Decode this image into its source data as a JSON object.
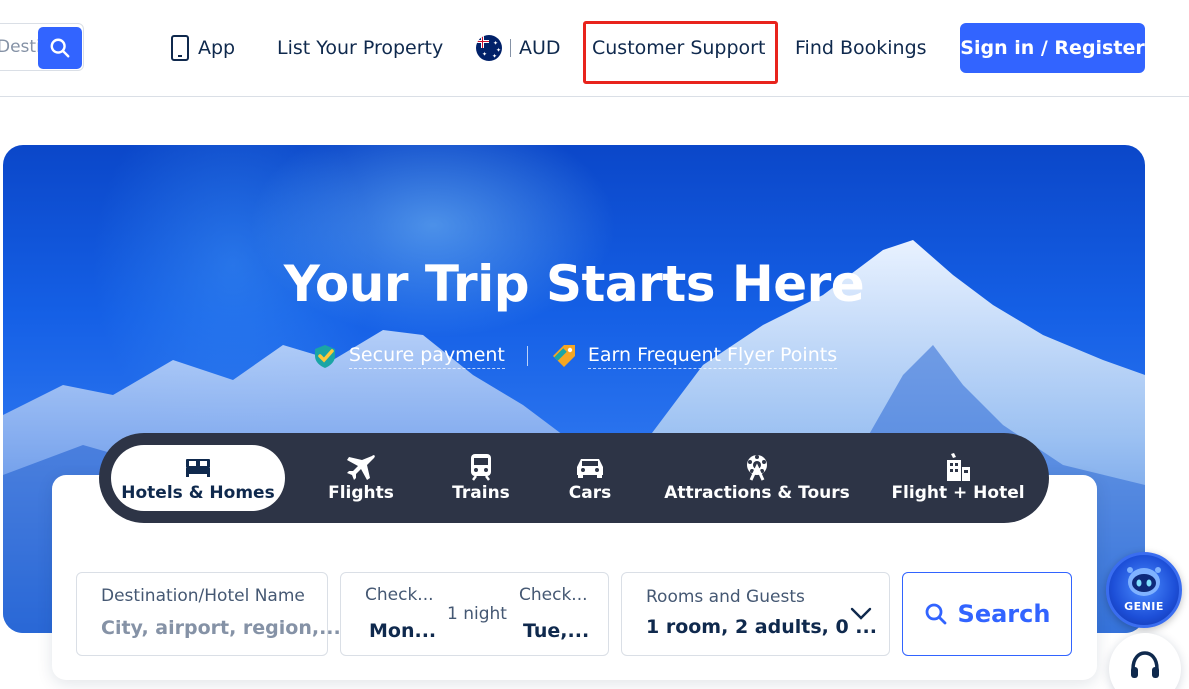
{
  "header": {
    "search_placeholder": "Desti...",
    "search_icon": "search-icon",
    "nav": {
      "app_label": "App",
      "list_property_label": "List Your Property",
      "currency_label": "AUD",
      "customer_support_label": "Customer Support",
      "find_bookings_label": "Find Bookings",
      "signin_label": "Sign in / Register"
    },
    "accent_color": "#3264ff",
    "highlight_color": "#e8231c"
  },
  "hero": {
    "title": "Your Trip Starts Here",
    "badges": [
      "Secure payment",
      "Earn Frequent Flyer Points"
    ]
  },
  "tabs": [
    {
      "label": "Hotels & Homes",
      "icon": "bed-icon",
      "active": true
    },
    {
      "label": "Flights",
      "icon": "plane-icon",
      "active": false
    },
    {
      "label": "Trains",
      "icon": "train-icon",
      "active": false
    },
    {
      "label": "Cars",
      "icon": "car-icon",
      "active": false
    },
    {
      "label": "Attractions & Tours",
      "icon": "ferris-wheel-icon",
      "active": false
    },
    {
      "label": "Flight + Hotel",
      "icon": "flight-hotel-icon",
      "active": false
    }
  ],
  "search_form": {
    "destination": {
      "label": "Destination/Hotel Name",
      "placeholder": "City, airport, region,..."
    },
    "checkin": {
      "label": "Check...",
      "value": "Mon..."
    },
    "nights": "1 night",
    "checkout": {
      "label": "Check...",
      "value": "Tue,..."
    },
    "rooms": {
      "label": "Rooms and Guests",
      "value": "1 room, 2 adults, 0 ..."
    },
    "search_label": "Search"
  },
  "floating": {
    "genie_label": "GENIE"
  }
}
